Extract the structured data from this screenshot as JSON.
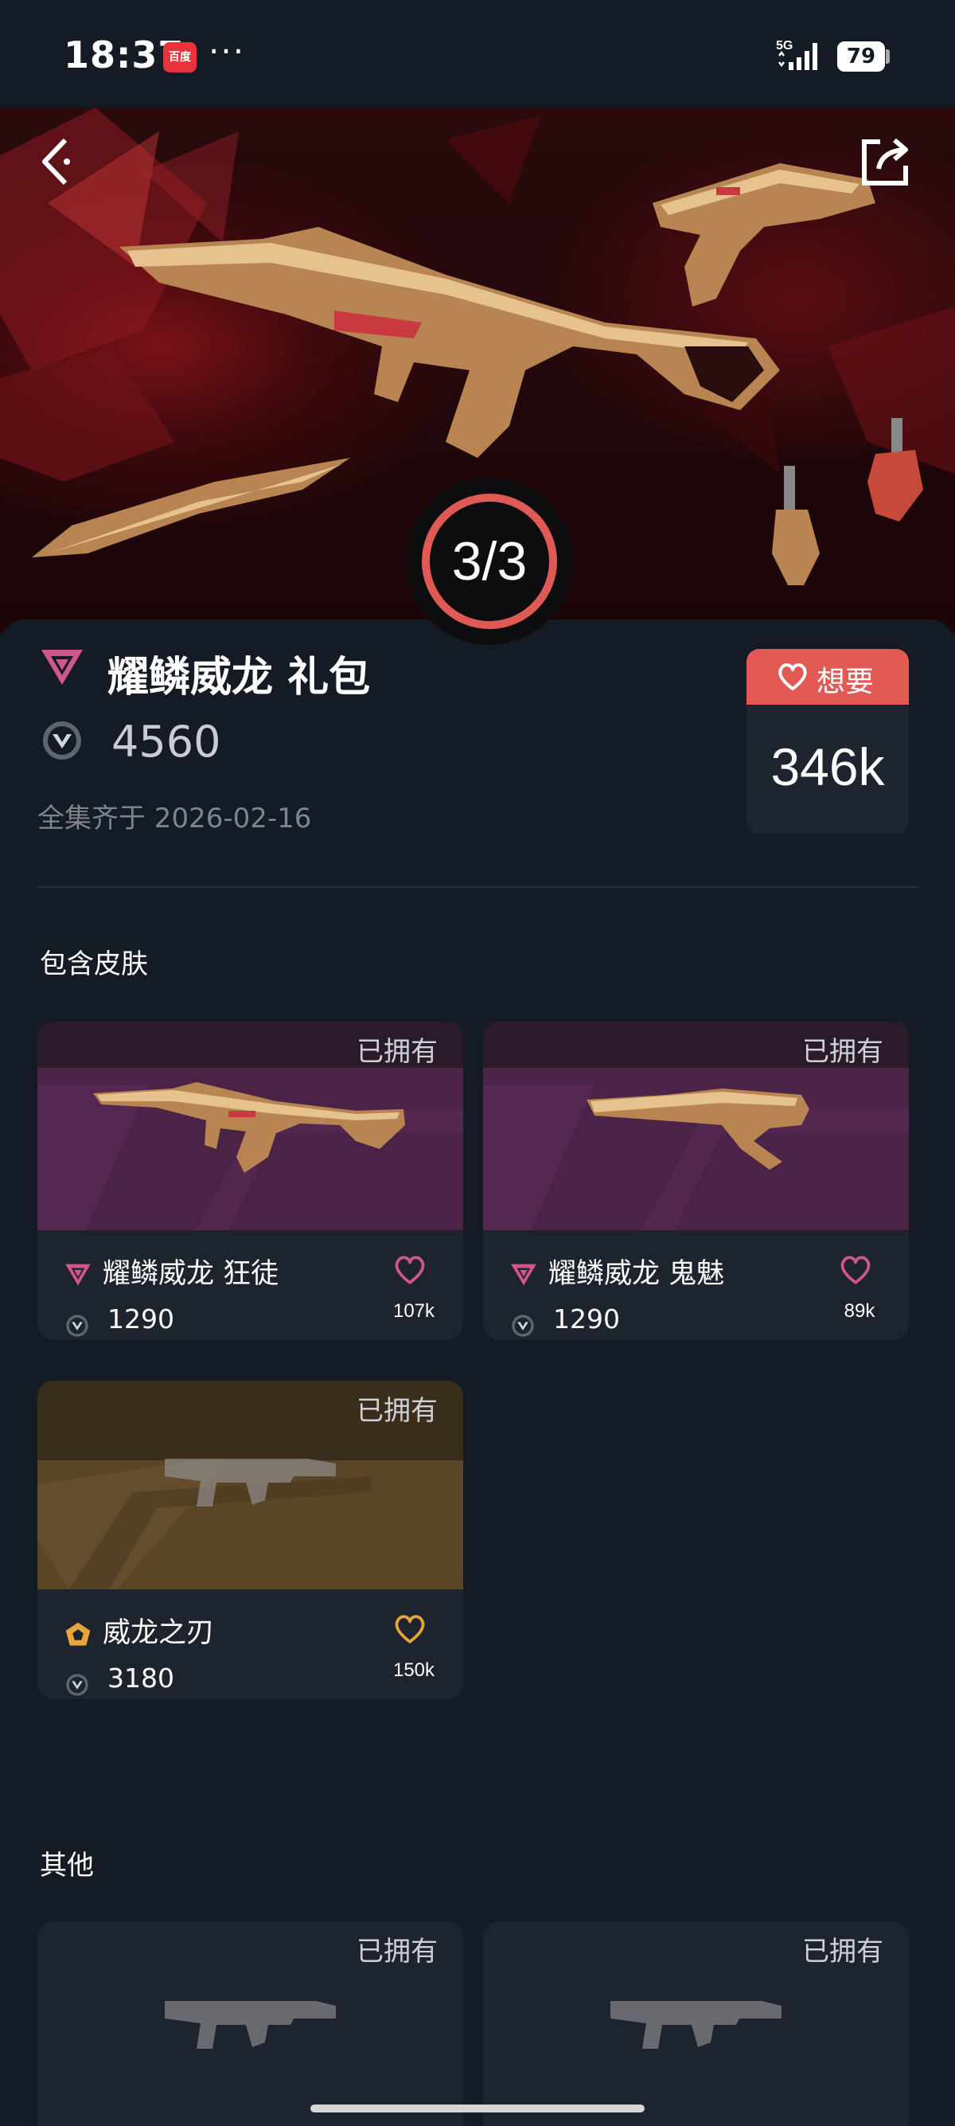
{
  "status_bar": {
    "time": "18:37",
    "app_badge": "百度",
    "dots": "···",
    "network": "5G",
    "battery": "79"
  },
  "hero": {
    "counter": "3/3"
  },
  "bundle": {
    "title": "耀鳞威龙 礼包",
    "price": "4560",
    "date": "全集齐于 2026-02-16",
    "wish_label": "想要",
    "wish_count": "346k"
  },
  "sections": {
    "included": "包含皮肤",
    "other": "其他"
  },
  "skins": [
    {
      "name": "耀鳞威龙 狂徒",
      "price": "1290",
      "owned": "已拥有",
      "wants": "107k",
      "tier": "premium"
    },
    {
      "name": "耀鳞威龙 鬼魅",
      "price": "1290",
      "owned": "已拥有",
      "wants": "89k",
      "tier": "premium"
    },
    {
      "name": "威龙之刃",
      "price": "3180",
      "owned": "已拥有",
      "wants": "150k",
      "tier": "exclusive"
    }
  ],
  "others": [
    {
      "owned": "已拥有"
    },
    {
      "owned": "已拥有"
    }
  ],
  "colors": {
    "accent": "#e35a55",
    "premium_pink": "#d0578a",
    "exclusive_gold": "#e7a63a",
    "background": "#151b24",
    "card": "#1e242e"
  }
}
